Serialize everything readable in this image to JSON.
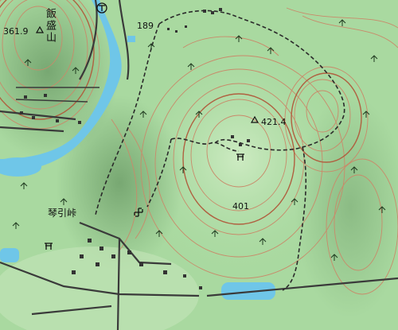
{
  "map": {
    "colors": {
      "forest": "#a9d9a0",
      "forest_shadow": "#6f9f6a",
      "forest_light": "#cdebc2",
      "contour": "#c98a6a",
      "contour_index": "#b06040",
      "water": "#6fc6e8",
      "road": "#3a3a3a",
      "trail": "#2a2a2a",
      "building": "#333333"
    },
    "labels": {
      "mountain_name": "飯盛山",
      "pass_name": "琴引峠",
      "elev_summit_west": "361.9",
      "elev_road": "189",
      "elev_summit_east": "421.4",
      "elev_peak_center": "401"
    },
    "symbols": {
      "triangulation_point": "triangle-icon",
      "shrine": "torii-icon",
      "temple": "manji-icon",
      "post_office": "post-office-icon",
      "tree": "tree-icon"
    }
  }
}
